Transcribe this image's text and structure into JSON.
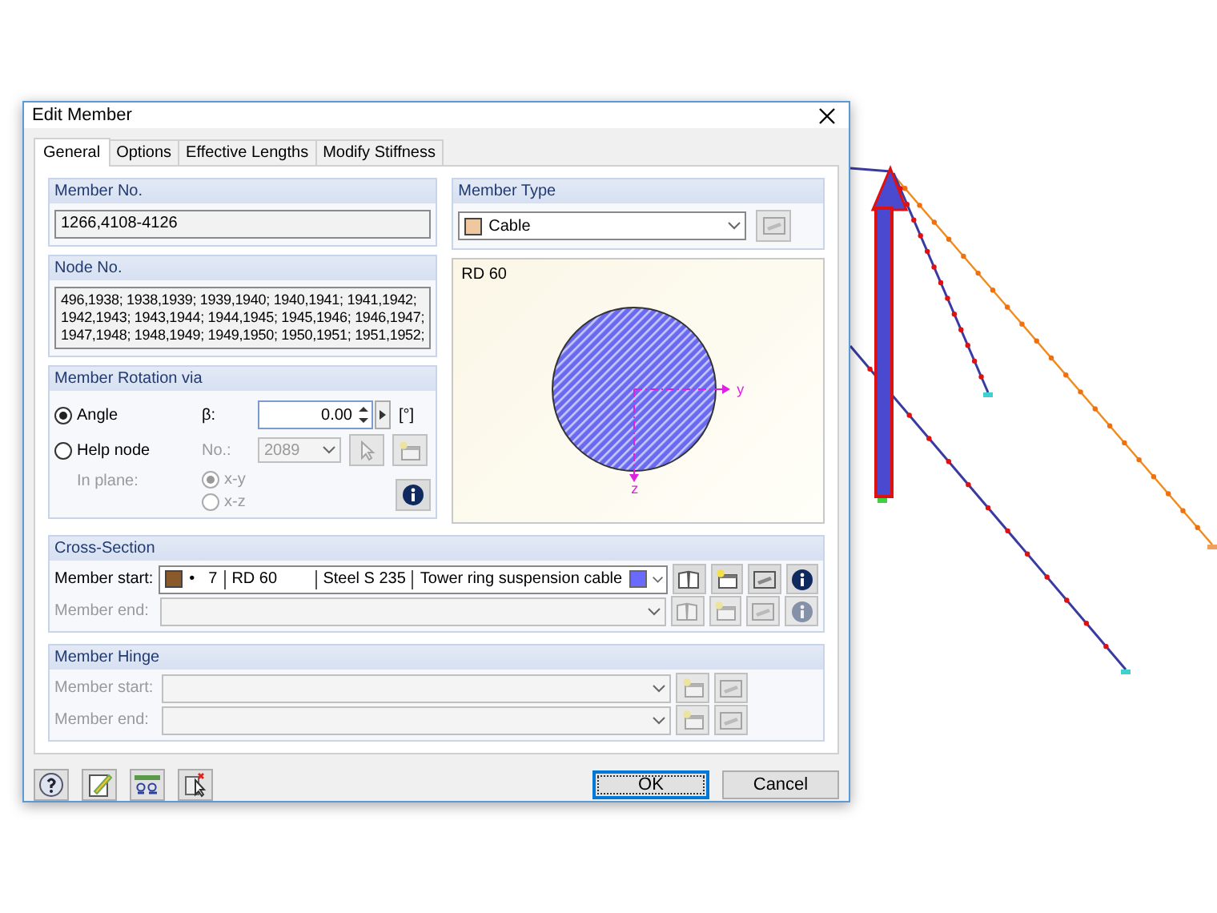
{
  "window": {
    "title": "Edit Member"
  },
  "tabs": [
    {
      "label": "General",
      "selected": true
    },
    {
      "label": "Options",
      "selected": false
    },
    {
      "label": "Effective Lengths",
      "selected": false
    },
    {
      "label": "Modify Stiffness",
      "selected": false
    }
  ],
  "member_no": {
    "label": "Member No.",
    "value": "1266,4108-4126"
  },
  "node_no": {
    "label": "Node No.",
    "lines": [
      "496,1938; 1938,1939; 1939,1940; 1940,1941; 1941,1942;",
      "1942,1943; 1943,1944; 1944,1945; 1945,1946; 1946,1947;",
      "1947,1948; 1948,1949; 1949,1950; 1950,1951; 1951,1952;"
    ]
  },
  "member_rotation": {
    "label": "Member Rotation via",
    "options": [
      {
        "label": "Angle",
        "selected": true
      },
      {
        "label": "Help node",
        "selected": false
      }
    ],
    "beta_label": "β:",
    "beta_value": "0.00",
    "beta_unit": "[°]",
    "node_label": "No.:",
    "node_value": "2089",
    "in_plane_label": "In plane:",
    "planes": [
      {
        "label": "x-y",
        "selected": true
      },
      {
        "label": "x-z",
        "selected": false
      }
    ]
  },
  "member_type": {
    "label": "Member Type",
    "value": "Cable",
    "color": "#f0c8a0"
  },
  "preview": {
    "title": "RD 60",
    "axes": [
      "y",
      "z"
    ]
  },
  "cross_section": {
    "label": "Cross-Section",
    "rows": [
      {
        "label": "Member start:",
        "disabled": false,
        "color": "#8b5a2b",
        "marker": "•",
        "number": "7",
        "name": "RD 60",
        "material": "Steel S 235",
        "description": "Tower ring suspension cable",
        "display": {
          "color": "#6a6aff"
        }
      },
      {
        "label": "Member end:",
        "disabled": true
      }
    ]
  },
  "member_hinge": {
    "label": "Member Hinge",
    "rows": [
      {
        "label": "Member start:",
        "disabled": true
      },
      {
        "label": "Member end:",
        "disabled": true
      }
    ]
  },
  "buttons": [
    {
      "label": "OK",
      "default": true
    },
    {
      "label": "Cancel",
      "default": false
    }
  ]
}
